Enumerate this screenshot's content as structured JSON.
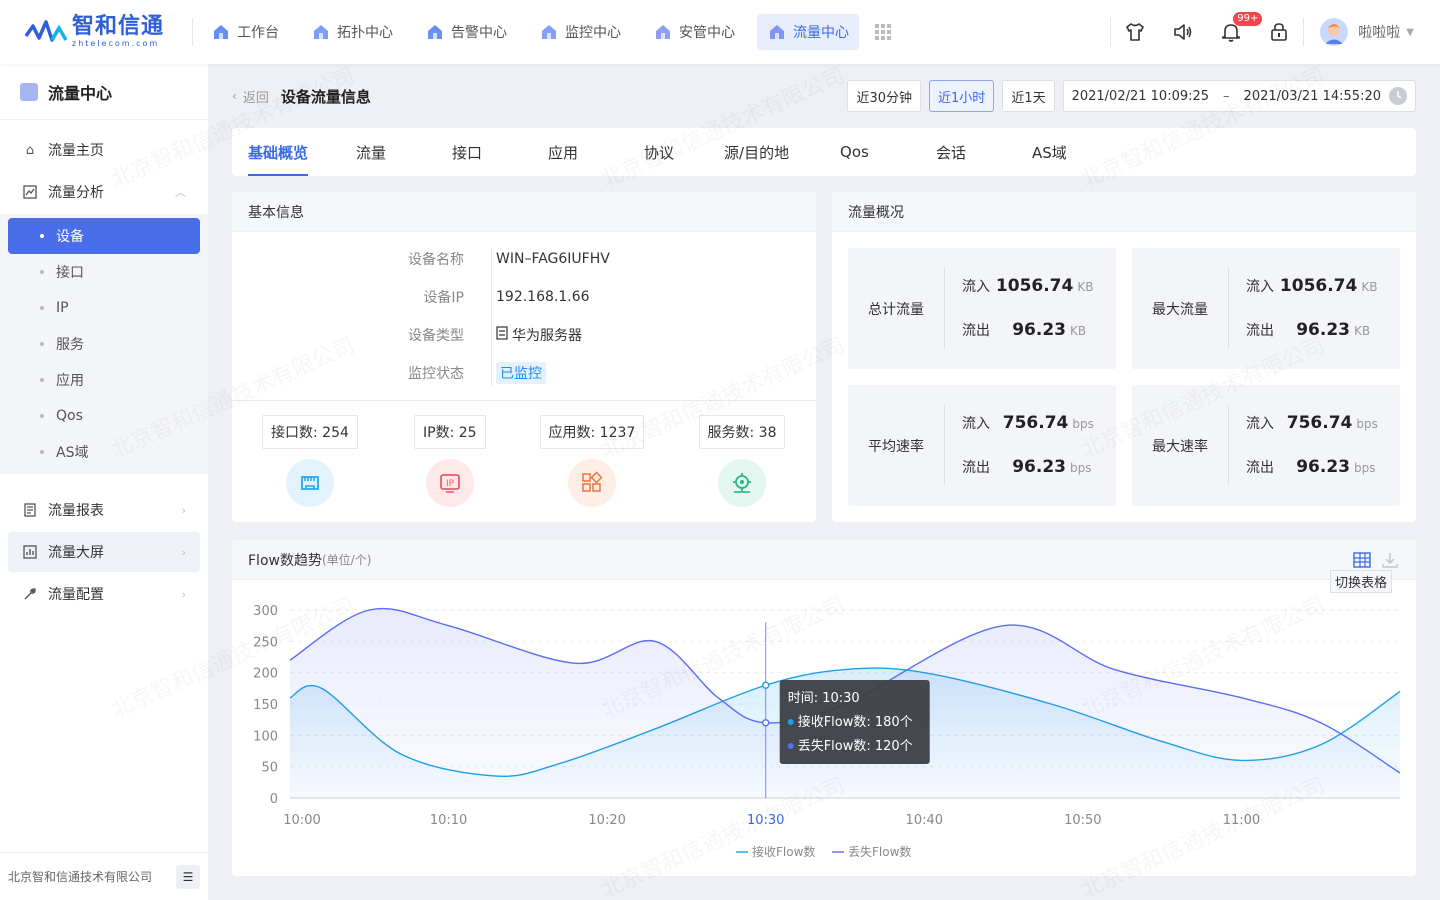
{
  "brand": {
    "name": "智和信通",
    "sub": "zhtelecom.com"
  },
  "nav": [
    {
      "label": "工作台",
      "icon": "home-icon",
      "color": "#4a7bf0"
    },
    {
      "label": "拓扑中心",
      "icon": "topology-icon",
      "color": "#6a8cf5"
    },
    {
      "label": "告警中心",
      "icon": "alarm-icon",
      "color": "#4f7cf0"
    },
    {
      "label": "监控中心",
      "icon": "monitor-icon",
      "color": "#6c8ff2"
    },
    {
      "label": "安管中心",
      "icon": "shield-icon",
      "color": "#7b8ff0"
    },
    {
      "label": "流量中心",
      "icon": "traffic-icon",
      "color": "#6f86ee",
      "active": true
    }
  ],
  "header": {
    "badge": "99+",
    "username": "啦啦啦"
  },
  "sidebar": {
    "title": "流量中心",
    "menu": [
      {
        "label": "流量主页",
        "icon": "home-icon"
      },
      {
        "label": "流量分析",
        "icon": "analysis-icon"
      }
    ],
    "submenu": [
      "设备",
      "接口",
      "IP",
      "服务",
      "应用",
      "Qos",
      "AS域"
    ],
    "menu2": [
      {
        "label": "流量报表",
        "icon": "report-icon"
      },
      {
        "label": "流量大屏",
        "icon": "screen-icon"
      },
      {
        "label": "流量配置",
        "icon": "wrench-icon"
      }
    ],
    "footer": "北京智和信通技术有限公司"
  },
  "page": {
    "back": "返回",
    "title": "设备流量信息",
    "time_buttons": [
      "近30分钟",
      "近1小时",
      "近1天"
    ],
    "active_time": "近1小时",
    "range_start": "2021/02/21 10:09:25",
    "range_sep": "–",
    "range_end": "2021/03/21 14:55:20"
  },
  "tabs": [
    "基础概览",
    "流量",
    "接口",
    "应用",
    "协议",
    "源/目的地",
    "Qos",
    "会话",
    "AS域"
  ],
  "basic": {
    "title": "基本信息",
    "fields": [
      {
        "k": "设备名称",
        "v": "WIN–FAG6IUFHV"
      },
      {
        "k": "设备IP",
        "v": "192.168.1.66"
      },
      {
        "k": "设备类型",
        "v": "华为服务器"
      },
      {
        "k": "监控状态",
        "v": "已监控"
      }
    ],
    "stats": [
      {
        "label": "接口数: 254",
        "icon": "interface-icon",
        "bg": "#e3f3fd",
        "fg": "#27a8e8"
      },
      {
        "label": "IP数: 25",
        "icon": "ip-icon",
        "bg": "#fde8ea",
        "fg": "#ee5a68"
      },
      {
        "label": "应用数: 1237",
        "icon": "app-icon",
        "bg": "#fdeee6",
        "fg": "#f27a45"
      },
      {
        "label": "服务数: 38",
        "icon": "service-icon",
        "bg": "#e3f6ef",
        "fg": "#28b589"
      }
    ]
  },
  "overview": {
    "title": "流量概况",
    "in_label": "流入",
    "out_label": "流出",
    "items": [
      {
        "name": "总计流量",
        "in": "1056.74",
        "in_unit": "KB",
        "out": "96.23",
        "out_unit": "KB"
      },
      {
        "name": "最大流量",
        "in": "1056.74",
        "in_unit": "KB",
        "out": "96.23",
        "out_unit": "KB"
      },
      {
        "name": "平均速率",
        "in": "756.74",
        "in_unit": "bps",
        "out": "96.23",
        "out_unit": "bps"
      },
      {
        "name": "最大速率",
        "in": "756.74",
        "in_unit": "bps",
        "out": "96.23",
        "out_unit": "bps"
      }
    ]
  },
  "flow_chart": {
    "title": "Flow数趋势",
    "unit": "(单位/个)",
    "switch_label": "切换表格",
    "tooltip": {
      "time_label": "时间:",
      "time": "10:30",
      "s1": "接收Flow数:",
      "s1v": "180个",
      "s2": "丢失Flow数:",
      "s2v": "120个"
    }
  },
  "chart_data": {
    "type": "area",
    "x": [
      "10:00",
      "10:10",
      "10:20",
      "10:30",
      "10:40",
      "10:50",
      "11:00"
    ],
    "highlight_x": "10:30",
    "ylim": [
      0,
      300
    ],
    "yticks": [
      0,
      50,
      100,
      150,
      200,
      250,
      300
    ],
    "series": [
      {
        "name": "接收Flow数",
        "color": "#1ea0e6",
        "points": [
          [
            0,
            160
          ],
          [
            2,
            175
          ],
          [
            7,
            70
          ],
          [
            13,
            35
          ],
          [
            17,
            55
          ],
          [
            23,
            110
          ],
          [
            30,
            180
          ],
          [
            35,
            205
          ],
          [
            40,
            200
          ],
          [
            48,
            150
          ],
          [
            55,
            90
          ],
          [
            60,
            60
          ],
          [
            65,
            85
          ],
          [
            70,
            170
          ]
        ]
      },
      {
        "name": "丢失Flow数",
        "color": "#5a6ef0",
        "points": [
          [
            0,
            220
          ],
          [
            5,
            300
          ],
          [
            10,
            275
          ],
          [
            18,
            215
          ],
          [
            23,
            250
          ],
          [
            27,
            160
          ],
          [
            30,
            120
          ],
          [
            35,
            150
          ],
          [
            45,
            275
          ],
          [
            52,
            205
          ],
          [
            60,
            160
          ],
          [
            65,
            120
          ],
          [
            70,
            40
          ]
        ]
      }
    ]
  },
  "colors": {
    "accent": "#3b6ae8",
    "active_menu": "#4a6ee8"
  }
}
